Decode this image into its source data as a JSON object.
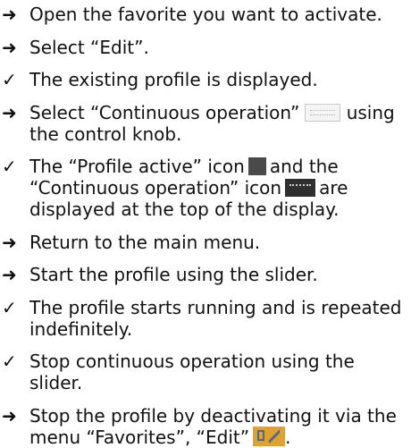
{
  "markers": {
    "action": "➜",
    "result": "✓"
  },
  "icons": {
    "continuous_operation_light": "continuous-operation-icon",
    "profile_active": "profile-active-icon",
    "continuous_operation_dark": "continuous-operation-icon",
    "favorites_edit": "favorites-edit-icon"
  },
  "steps": [
    {
      "type": "action",
      "text": "Open the favorite you want to activate."
    },
    {
      "type": "action",
      "text": "Select “Edit”."
    },
    {
      "type": "result",
      "text": "The existing profile is displayed."
    },
    {
      "type": "action",
      "text_a": "Select “Continuous operation”",
      "text_b": "using the control knob."
    },
    {
      "type": "result",
      "text_a": "The “Profile active” icon",
      "text_b": "and the “Continuous operation” icon",
      "text_c": "are displayed at the top of the display."
    },
    {
      "type": "action",
      "text": "Return to the main menu."
    },
    {
      "type": "action",
      "text": "Start the profile using the slider."
    },
    {
      "type": "result",
      "text": "The profile starts running and is repeated indefinitely."
    },
    {
      "type": "result",
      "text": "Stop continuous operation using the slider."
    },
    {
      "type": "action",
      "text_a": "Stop the profile by deactivating it via the menu “Favorites”, “Edit”",
      "text_b": "."
    }
  ]
}
